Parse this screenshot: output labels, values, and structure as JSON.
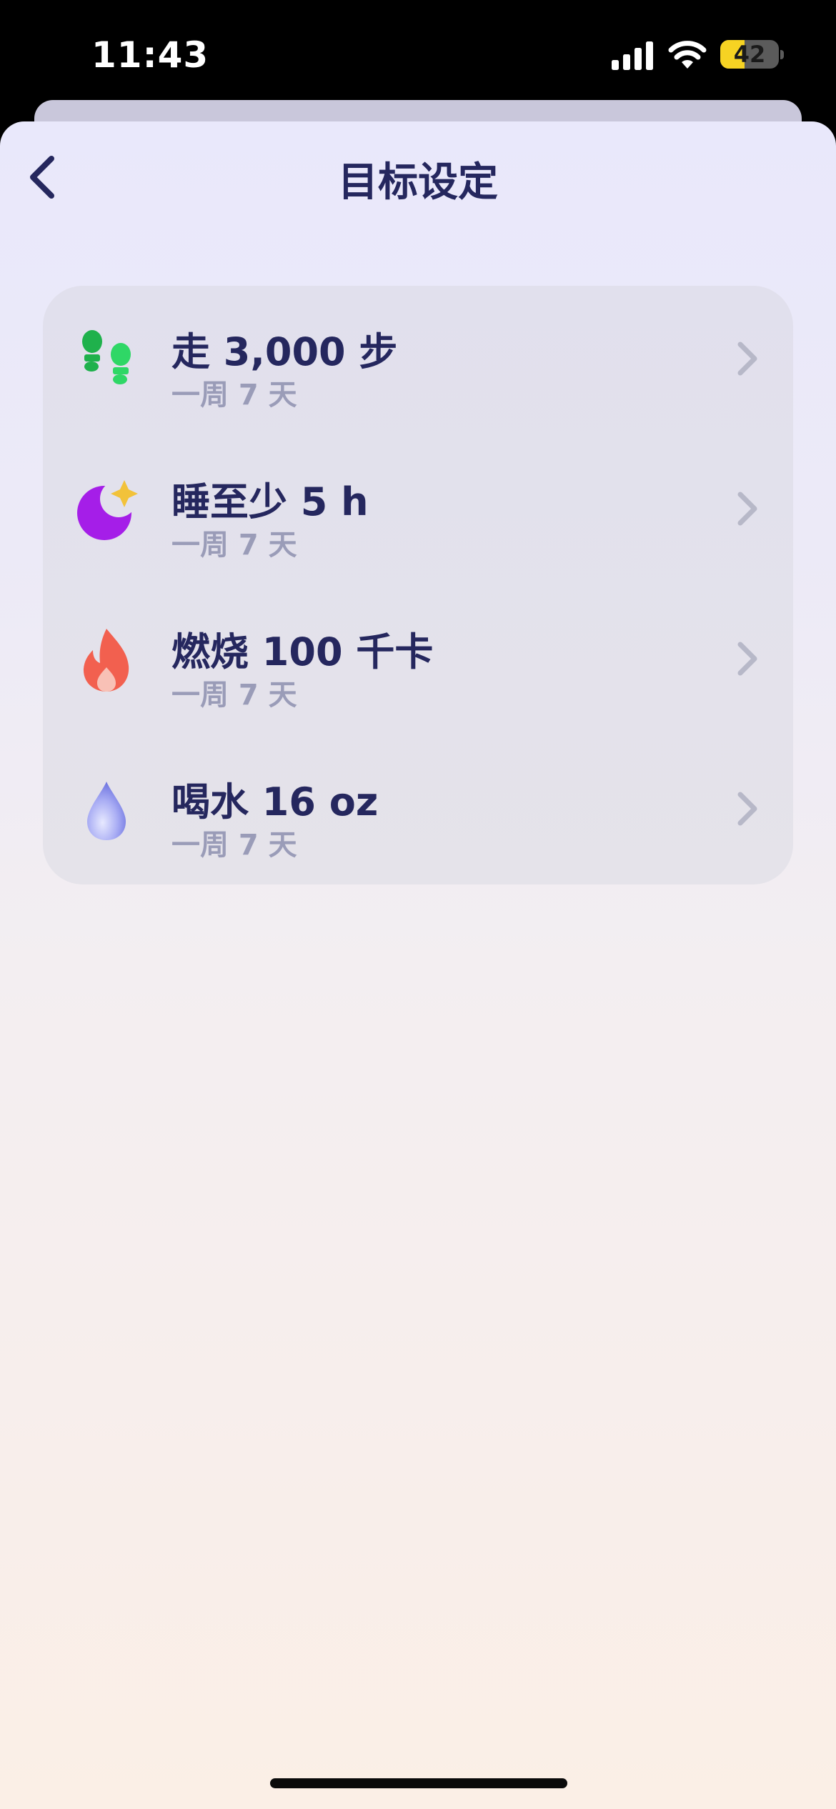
{
  "status_bar": {
    "time": "11:43",
    "battery_level": "42",
    "battery_fraction": 0.42,
    "colors": {
      "battery_fill": "#f6d323",
      "battery_empty": "#5b5b5b"
    }
  },
  "header": {
    "title": "目标设定",
    "back_icon": "chevron-left-icon"
  },
  "goals": [
    {
      "icon": "footsteps-icon",
      "title": "走 3,000 步",
      "subtitle": "一周 7 天",
      "color": "#22c55e"
    },
    {
      "icon": "moon-star-icon",
      "title": "睡至少 5 h",
      "subtitle": "一周 7 天",
      "color": "#a51ee8"
    },
    {
      "icon": "flame-icon",
      "title": "燃烧 100 千卡",
      "subtitle": "一周 7 天",
      "color": "#f2604f"
    },
    {
      "icon": "water-drop-icon",
      "title": "喝水 16 oz",
      "subtitle": "一周 7 天",
      "color": "#8b8ff0"
    }
  ],
  "theme": {
    "title_color": "#25275e",
    "subtitle_color": "#9a9cb8",
    "chevron_color": "#b7b8c8"
  }
}
